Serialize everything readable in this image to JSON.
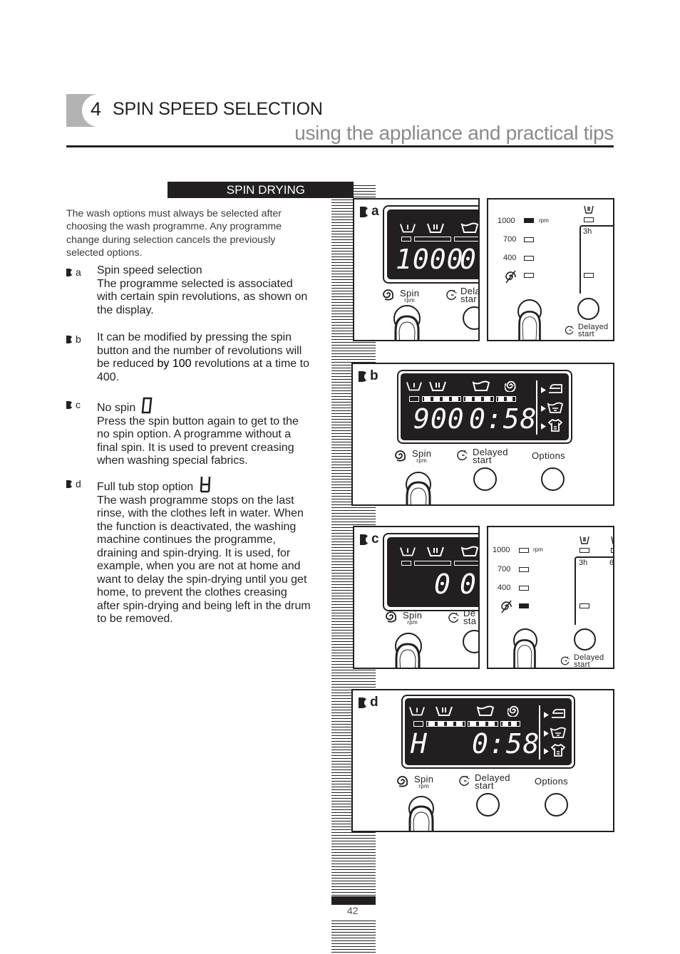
{
  "header": {
    "chapter_number": "4",
    "chapter_title": "SPIN SPEED SELECTION",
    "subtitle": "using the appliance and practical tips"
  },
  "section": {
    "title": "SPIN DRYING"
  },
  "intro": "The wash options must always be selected after choosing the wash programme. Any programme change during selection cancels the previously selected options.",
  "items": [
    {
      "marker": "a",
      "heading": "Spin speed selection",
      "text": "The programme selected is associated with certain spin revolutions, as shown on the display."
    },
    {
      "marker": "b",
      "text_pre": "It can be modified by pressing the spin button and the number of revolutions will be reduced ",
      "text_bold": "by 100",
      "text_post": " revolutions at a time to 400."
    },
    {
      "marker": "c",
      "heading": "No spin",
      "heading_glyph": "0",
      "text": "Press the spin button again to get to the no spin option. A programme without a final spin. It is used to prevent creasing when washing special fabrics."
    },
    {
      "marker": "d",
      "heading": "Full tub stop option",
      "heading_glyph": "H",
      "text": "The wash programme stops on the last rinse, with the clothes left in water. When the function is deactivated, the washing machine continues the programme, draining and spin-drying. It is used, for example, when you are not at home and want to delay the spin-drying until you get home, to prevent the clothes creasing after spin-drying and being left in the drum to be removed."
    }
  ],
  "figures": {
    "a": {
      "label": "a",
      "lcd_speed": "1000",
      "lcd_time": "0:",
      "spin_label": "Spin",
      "spin_unit": "rpm",
      "delay_label_partial": "Dela",
      "delay_label2_partial": "star",
      "alt_panel": {
        "speeds": [
          "1000",
          "700",
          "400"
        ],
        "unit": "rpm",
        "active_index": 0,
        "delay_hours": "3h",
        "delay_label": "Delayed",
        "delay_label2": "start"
      }
    },
    "b": {
      "label": "b",
      "lcd_speed": "900",
      "lcd_time": "0:58",
      "spin_label": "Spin",
      "spin_unit": "rpm",
      "delay_label": "Delayed",
      "delay_label2": "start",
      "options_label": "Options"
    },
    "c": {
      "label": "c",
      "lcd_speed": "0",
      "lcd_time": "0:",
      "spin_label": "Spin",
      "spin_unit": "rpm",
      "delay_label_partial": "De",
      "delay_label2_partial": "sta",
      "alt_panel": {
        "speeds": [
          "1000",
          "700",
          "400"
        ],
        "unit": "rpm",
        "active_index": 3,
        "delay_hours": "3h",
        "delay_hours2_partial": "6",
        "delay_label": "Delayed",
        "delay_label2": "start"
      }
    },
    "d": {
      "label": "d",
      "lcd_speed": "H",
      "lcd_time": "0:58",
      "spin_label": "Spin",
      "spin_unit": "rpm",
      "delay_label": "Delayed",
      "delay_label2": "start",
      "options_label": "Options"
    }
  },
  "footer": {
    "page_number": "42"
  }
}
